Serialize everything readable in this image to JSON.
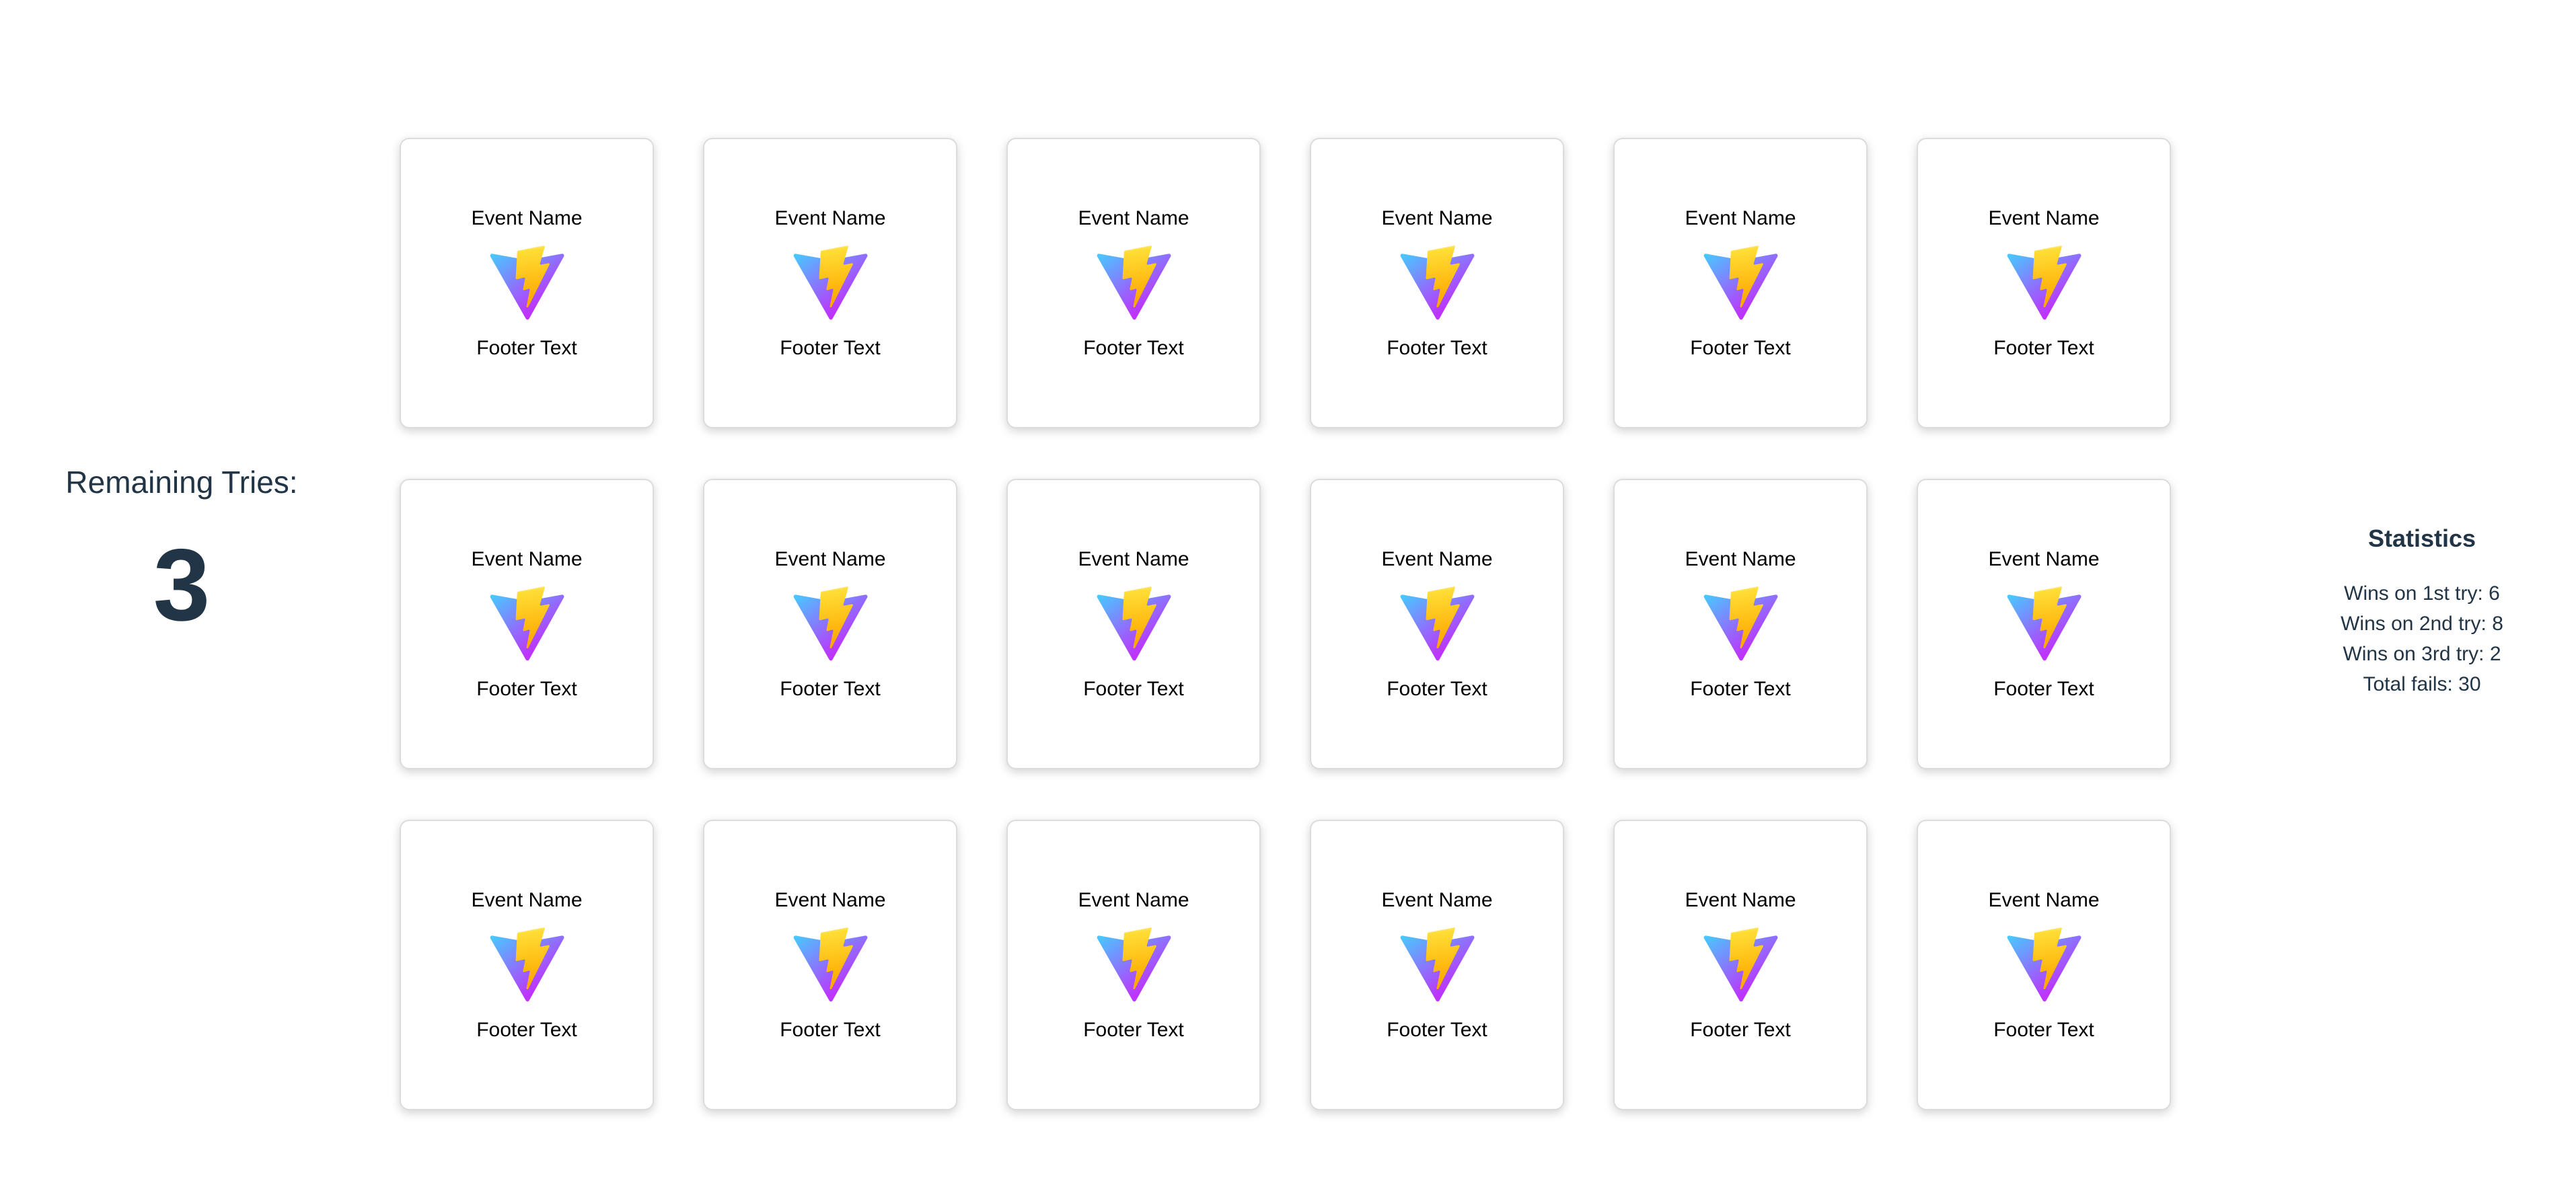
{
  "remaining": {
    "label": "Remaining Tries:",
    "value": "3"
  },
  "cards": [
    {
      "title": "Event Name",
      "footer": "Footer Text",
      "icon": "vite-logo-icon"
    },
    {
      "title": "Event Name",
      "footer": "Footer Text",
      "icon": "vite-logo-icon"
    },
    {
      "title": "Event Name",
      "footer": "Footer Text",
      "icon": "vite-logo-icon"
    },
    {
      "title": "Event Name",
      "footer": "Footer Text",
      "icon": "vite-logo-icon"
    },
    {
      "title": "Event Name",
      "footer": "Footer Text",
      "icon": "vite-logo-icon"
    },
    {
      "title": "Event Name",
      "footer": "Footer Text",
      "icon": "vite-logo-icon"
    },
    {
      "title": "Event Name",
      "footer": "Footer Text",
      "icon": "vite-logo-icon"
    },
    {
      "title": "Event Name",
      "footer": "Footer Text",
      "icon": "vite-logo-icon"
    },
    {
      "title": "Event Name",
      "footer": "Footer Text",
      "icon": "vite-logo-icon"
    },
    {
      "title": "Event Name",
      "footer": "Footer Text",
      "icon": "vite-logo-icon"
    },
    {
      "title": "Event Name",
      "footer": "Footer Text",
      "icon": "vite-logo-icon"
    },
    {
      "title": "Event Name",
      "footer": "Footer Text",
      "icon": "vite-logo-icon"
    },
    {
      "title": "Event Name",
      "footer": "Footer Text",
      "icon": "vite-logo-icon"
    },
    {
      "title": "Event Name",
      "footer": "Footer Text",
      "icon": "vite-logo-icon"
    },
    {
      "title": "Event Name",
      "footer": "Footer Text",
      "icon": "vite-logo-icon"
    },
    {
      "title": "Event Name",
      "footer": "Footer Text",
      "icon": "vite-logo-icon"
    },
    {
      "title": "Event Name",
      "footer": "Footer Text",
      "icon": "vite-logo-icon"
    },
    {
      "title": "Event Name",
      "footer": "Footer Text",
      "icon": "vite-logo-icon"
    }
  ],
  "statistics": {
    "title": "Statistics",
    "lines": [
      "Wins on 1st try: 6",
      "Wins on 2nd try: 8",
      "Wins on 3rd try: 2",
      "Total fails: 30"
    ]
  },
  "colors": {
    "text": "#213547",
    "logo_blue": "#41d1ff",
    "logo_purple": "#bd34fe",
    "bolt_yellow": "#ffea83",
    "bolt_orange": "#ffa800"
  }
}
